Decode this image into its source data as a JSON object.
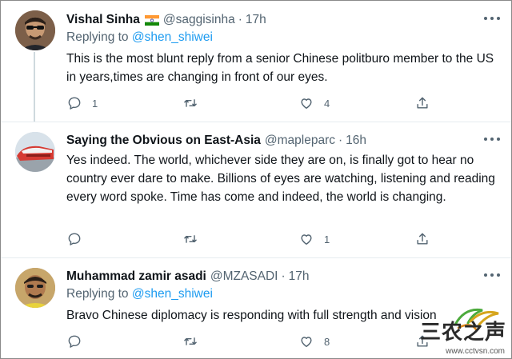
{
  "tweets": [
    {
      "name": "Vishal Sinha",
      "has_flag": true,
      "handle": "@saggisinha",
      "separator": "·",
      "time": "17h",
      "replying_prefix": "Replying to",
      "replying_to": "@shen_shiwei",
      "text": "This is the most blunt reply from a senior Chinese politburo member to the US in years,times are changing in front of our eyes.",
      "reply_count": "1",
      "retweet_count": "",
      "like_count": "4"
    },
    {
      "name": "Saying the Obvious on East-Asia",
      "has_flag": false,
      "handle": "@mapleparc",
      "separator": "·",
      "time": "16h",
      "text": "Yes indeed. The world, whichever side they are on, is finally got to hear no country ever dare to make. Billions of eyes are watching, listening and reading every word spoke.  Time has come and indeed, the world is changing.",
      "reply_count": "",
      "retweet_count": "",
      "like_count": "1"
    },
    {
      "name": "Muhammad zamir asadi",
      "has_flag": false,
      "handle": "@MZASADI",
      "separator": "·",
      "time": "17h",
      "replying_prefix": "Replying to",
      "replying_to": "@shen_shiwei",
      "text": "Bravo Chinese diplomacy is responding with full strength and vision",
      "reply_count": "",
      "retweet_count": "",
      "like_count": "8"
    }
  ],
  "icons": [
    "reply-icon",
    "retweet-icon",
    "like-icon",
    "share-icon",
    "more-icon"
  ],
  "colors": {
    "link": "#1d9bf0",
    "secondary": "#536471",
    "text": "#0f1419"
  },
  "watermark": {
    "text": "三农之声",
    "url": "www.cctvsn.com"
  }
}
